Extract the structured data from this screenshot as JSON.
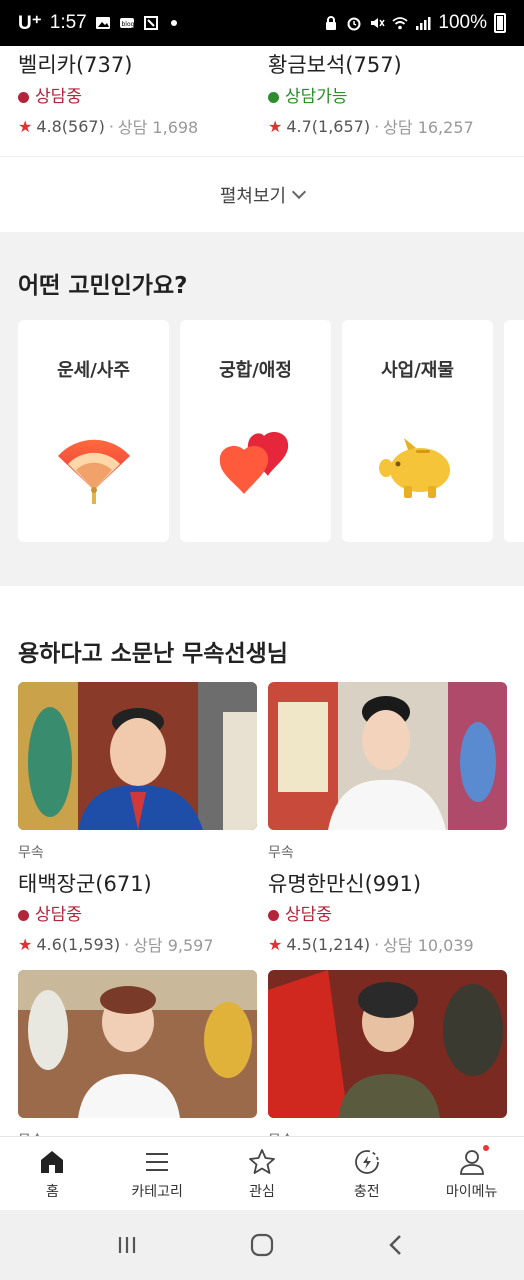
{
  "status_bar": {
    "carrier": "U⁺",
    "time": "1:57",
    "battery": "100%"
  },
  "top_counselors": [
    {
      "name": "벨리카(737)",
      "status": "상담중",
      "status_color": "#b3253a",
      "rating": "4.8(567)",
      "consult": "상담 1,698"
    },
    {
      "name": "황금보석(757)",
      "status": "상담가능",
      "status_color": "#2e8b2e",
      "rating": "4.7(1,657)",
      "consult": "상담 16,257"
    }
  ],
  "expand": {
    "label": "펼쳐보기"
  },
  "concern": {
    "title": "어떤 고민인가요?",
    "categories": [
      {
        "label": "운세/사주",
        "icon": "fan-icon"
      },
      {
        "label": "궁합/애정",
        "icon": "hearts-icon"
      },
      {
        "label": "사업/재물",
        "icon": "piggy-bank-icon"
      }
    ]
  },
  "teachers": {
    "title": "용하다고 소문난 무속선생님",
    "items": [
      {
        "category": "무속",
        "name": "태백장군(671)",
        "status": "상담중",
        "status_color": "#b3253a",
        "rating": "4.6(1,593)",
        "consult": "상담 9,597"
      },
      {
        "category": "무속",
        "name": "유명한만신(991)",
        "status": "상담중",
        "status_color": "#b3253a",
        "rating": "4.5(1,214)",
        "consult": "상담 10,039"
      },
      {
        "category": "무속",
        "name": "",
        "status": "",
        "rating": "",
        "consult": ""
      },
      {
        "category": "무속",
        "name": "",
        "status": "",
        "rating": "",
        "consult": ""
      }
    ]
  },
  "bottom_nav": [
    {
      "label": "홈",
      "icon": "home-icon"
    },
    {
      "label": "카테고리",
      "icon": "menu-icon"
    },
    {
      "label": "관심",
      "icon": "star-icon"
    },
    {
      "label": "충전",
      "icon": "charge-icon"
    },
    {
      "label": "마이메뉴",
      "icon": "person-icon"
    }
  ],
  "colors": {
    "accent_red": "#d33",
    "status_busy": "#b3253a",
    "status_available": "#2e8b2e"
  }
}
